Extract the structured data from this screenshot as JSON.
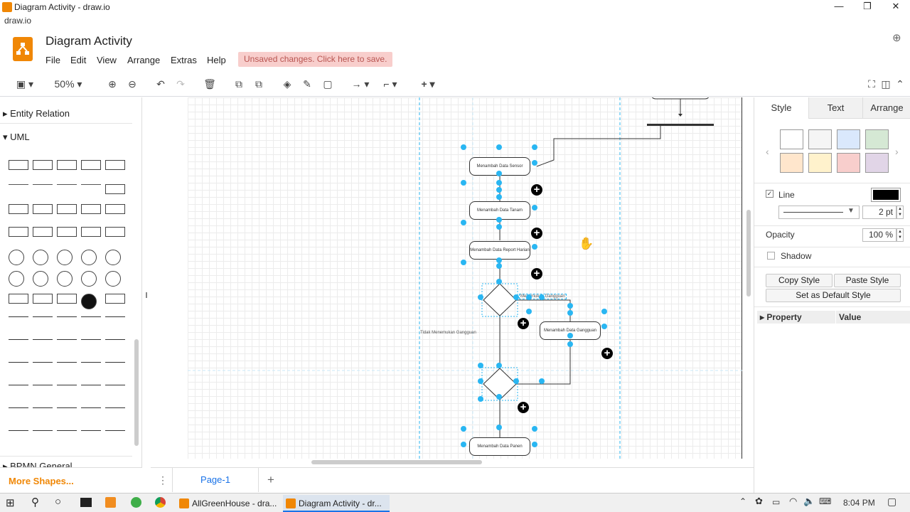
{
  "window": {
    "title": "Diagram Activity - draw.io",
    "url": "draw.io"
  },
  "app": {
    "name": "Diagram Activity",
    "unsaved": "Unsaved changes. Click here to save."
  },
  "menu": [
    "File",
    "Edit",
    "View",
    "Arrange",
    "Extras",
    "Help"
  ],
  "toolbar": {
    "zoom": "50%"
  },
  "sidebar": {
    "entity": "Entity Relation",
    "uml": "UML",
    "bpmn": "BPMN General",
    "more": "More Shapes..."
  },
  "canvas": {
    "nodes": [
      "Menambah Data Sensor",
      "Menambah Data Tanam",
      "Menambah Data Report Harian",
      "Menambah Data Gangguan",
      "Menambah Data Panen"
    ],
    "labels": {
      "yes": "Menemukan Gangguan",
      "no": "Tidak Menemukan Gangguan"
    }
  },
  "page_tab": "Page-1",
  "panel": {
    "tabs": [
      "Style",
      "Text",
      "Arrange"
    ],
    "line": "Line",
    "line_width": "2 pt",
    "opacity": "Opacity",
    "opacity_value": "100 %",
    "shadow": "Shadow",
    "copy": "Copy Style",
    "paste": "Paste Style",
    "default": "Set as Default Style",
    "property": "Property",
    "value": "Value",
    "colors": [
      "#ffffff",
      "#f5f5f5",
      "#dae8fc",
      "#d5e8d4",
      "#ffe6cc",
      "#fff2cc",
      "#f8cecc",
      "#e1d5e7"
    ]
  },
  "taskbar": {
    "app1": "AllGreenHouse - dra...",
    "app2": "Diagram Activity - dr...",
    "time": "8:04 PM"
  }
}
